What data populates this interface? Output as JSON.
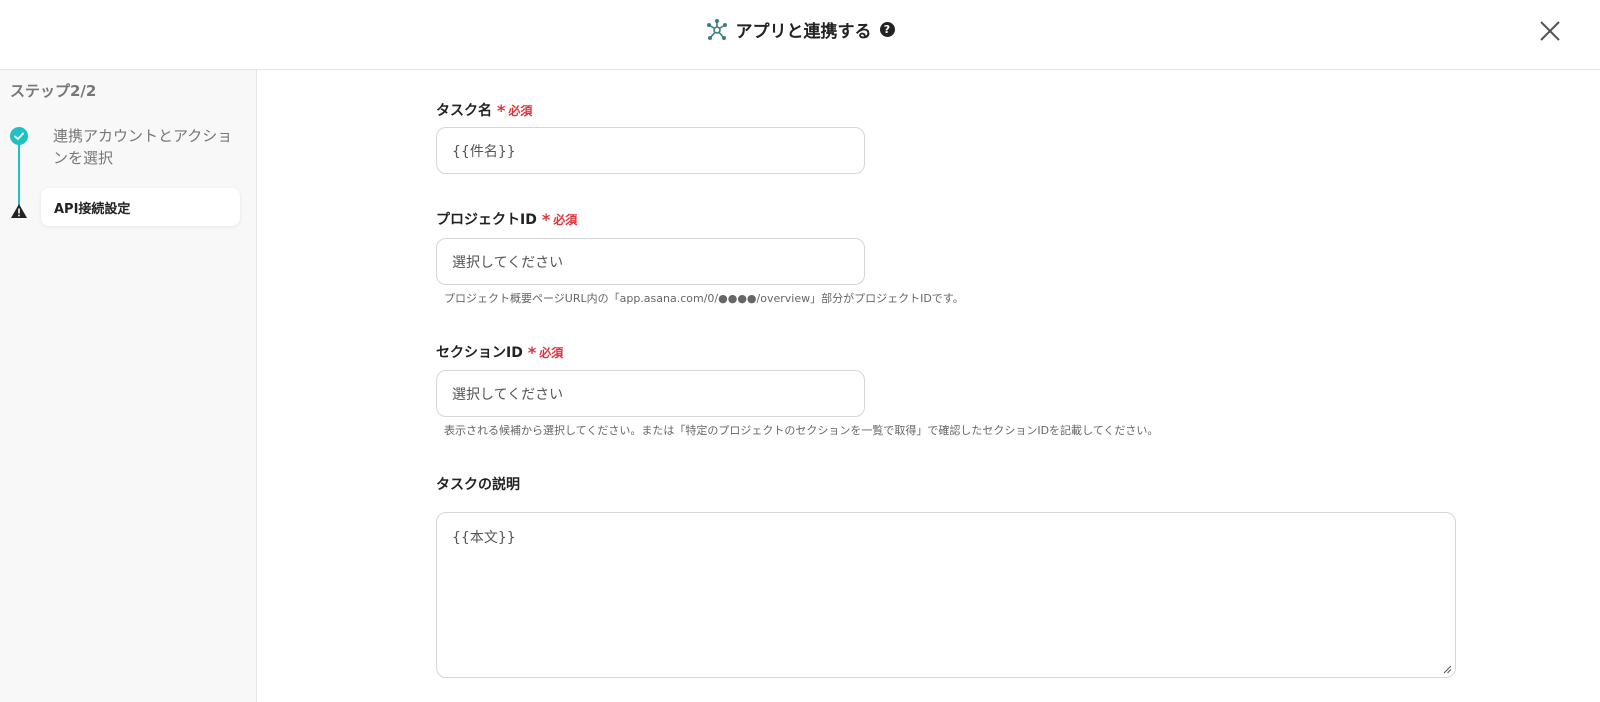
{
  "header": {
    "title": "アプリと連携する",
    "help_glyph": "?",
    "integration_icon": "network-icon",
    "close_icon": "close-icon"
  },
  "sidebar": {
    "step_heading": "ステップ2/2",
    "steps": [
      {
        "label": "連携アカウントとアクションを選択",
        "status": "completed",
        "icon": "check-circle-icon"
      },
      {
        "label": "API接続設定",
        "status": "warning",
        "icon": "warning-icon"
      }
    ],
    "accent_color": "#1fc1c7"
  },
  "form": {
    "required_text": "必須",
    "required_color": "#e0323c",
    "task_name": {
      "label": "タスク名",
      "value": "{{件名}}"
    },
    "project_id": {
      "label": "プロジェクトID",
      "placeholder": "選択してください",
      "hint": "プロジェクト概要ページURL内の「app.asana.com/0/●●●●/overview」部分がプロジェクトIDです。"
    },
    "section_id": {
      "label": "セクションID",
      "placeholder": "選択してください",
      "hint": "表示される候補から選択してください。または「特定のプロジェクトのセクションを一覧で取得」で確認したセクションIDを記載してください。"
    },
    "task_description": {
      "label": "タスクの説明",
      "value": "{{本文}}"
    }
  }
}
